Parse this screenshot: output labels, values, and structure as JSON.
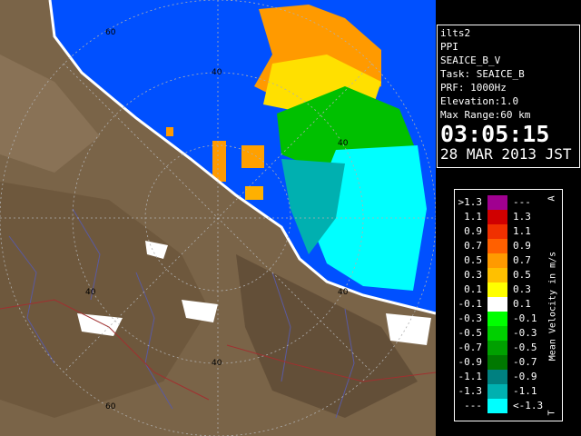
{
  "info": {
    "site": "ilts2",
    "scan_type": "PPI",
    "product": "SEAICE_B_V",
    "task": "Task: SEAICE_B",
    "prf": "PRF: 1000Hz",
    "elevation": "Elevation:1.0",
    "max_range": "Max Range:60 km",
    "time": "03:05:15",
    "date": "28 MAR 2013 JST"
  },
  "map": {
    "range_labels": [
      "60",
      "40",
      "40",
      "40",
      "40",
      "40",
      "60"
    ]
  },
  "legend": {
    "unit": "Mean Velocity in m/s",
    "side_top": "A",
    "side_bottom": "T",
    "rows": [
      {
        "lo": ">1.3",
        "hi": "---",
        "color": "#a00090"
      },
      {
        "lo": "1.1",
        "hi": "1.3",
        "color": "#d00000"
      },
      {
        "lo": "0.9",
        "hi": "1.1",
        "color": "#f03000"
      },
      {
        "lo": "0.7",
        "hi": "0.9",
        "color": "#ff6000"
      },
      {
        "lo": "0.5",
        "hi": "0.7",
        "color": "#ff9a00"
      },
      {
        "lo": "0.3",
        "hi": "0.5",
        "color": "#ffc000"
      },
      {
        "lo": "0.1",
        "hi": "0.3",
        "color": "#ffff00"
      },
      {
        "lo": "-0.1",
        "hi": "0.1",
        "color": "#ffffff"
      },
      {
        "lo": "-0.3",
        "hi": "-0.1",
        "color": "#00ff00"
      },
      {
        "lo": "-0.5",
        "hi": "-0.3",
        "color": "#00d000"
      },
      {
        "lo": "-0.7",
        "hi": "-0.5",
        "color": "#00a000"
      },
      {
        "lo": "-0.9",
        "hi": "-0.7",
        "color": "#007800"
      },
      {
        "lo": "-1.1",
        "hi": "-0.9",
        "color": "#008080"
      },
      {
        "lo": "-1.3",
        "hi": "-1.1",
        "color": "#00b0b0"
      },
      {
        "lo": "---",
        "hi": "<-1.3",
        "color": "#00ffff"
      }
    ]
  },
  "colors": {
    "sea": "#0050ff",
    "land": "#7a6448",
    "ice_cyan": "#00ffff",
    "ice_green": "#00c000",
    "ice_orange": "#ff9a00"
  }
}
